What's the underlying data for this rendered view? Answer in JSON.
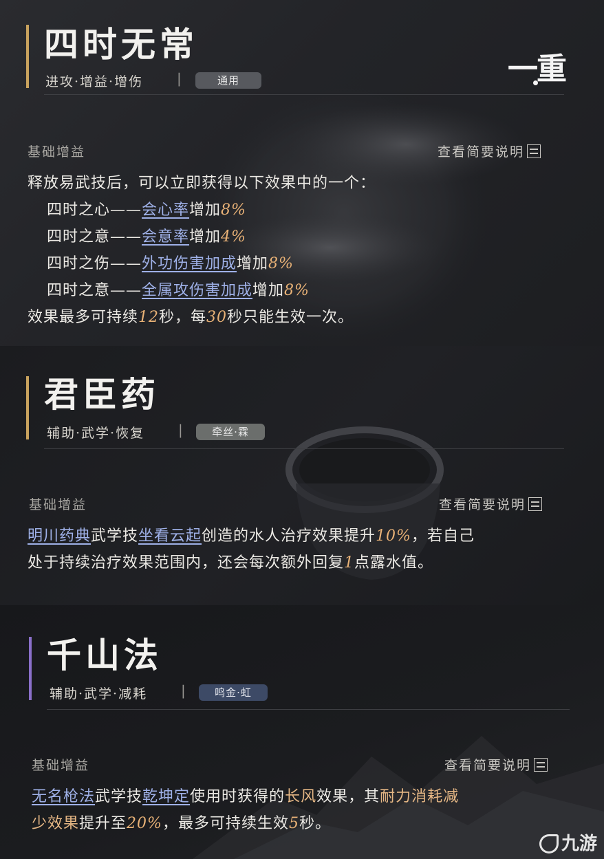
{
  "cards": [
    {
      "title": "四时无常",
      "tags": "进攻·增益·增伤",
      "chip": "通用",
      "rank": "一重",
      "section_label": "基础增益",
      "summary_label": "查看简要说明",
      "desc": {
        "l1": "释放易武技后，可以立即获得以下效果中的一个：",
        "r1": {
          "a": "四时之心——",
          "link": "会心率",
          "b": "增加",
          "num": "8%"
        },
        "r2": {
          "a": "四时之意——",
          "link": "会意率",
          "b": "增加",
          "num": "4%"
        },
        "r3": {
          "a": "四时之伤——",
          "link": "外功伤害加成",
          "b": "增加",
          "num": "8%"
        },
        "r4": {
          "a": "四时之意——",
          "link": "全属攻伤害加成",
          "b": "增加",
          "num": "8%"
        },
        "l6": {
          "a": "效果最多可持续",
          "n1": "12",
          "b": "秒，每",
          "n2": "30",
          "c": "秒只能生效一次。"
        }
      }
    },
    {
      "title": "君臣药",
      "tags": "辅助·武学·恢复",
      "chip": "牵丝·霖",
      "section_label": "基础增益",
      "summary_label": "查看简要说明",
      "desc": {
        "l1": {
          "link1": "明川药典",
          "a": "武学技",
          "link2": "坐看云起",
          "b": "创造的水人治疗效果提升",
          "num": "10%",
          "c": "，若自己"
        },
        "l2": {
          "a": "处于持续治疗效果范围内，还会每次额外回复",
          "num": "1",
          "b": "点露水值。"
        }
      }
    },
    {
      "title": "千山法",
      "tags": "辅助·武学·减耗",
      "chip": "鸣金·虹",
      "section_label": "基础增益",
      "summary_label": "查看简要说明",
      "desc": {
        "l1": {
          "link1": "无名枪法",
          "a": "武学技",
          "link2": "乾坤定",
          "b": "使用时获得的",
          "gold1": "长风",
          "c": "效果，其",
          "gold2": "耐力消耗减"
        },
        "l2": {
          "gold": "少效果",
          "a": "提升至",
          "num": "20%",
          "b": "，最多可持续生效",
          "num2": "5",
          "c": "秒。"
        }
      }
    }
  ],
  "watermark": "九游",
  "colors": {
    "accent_gold": "#c9a35e",
    "accent_purple": "#8a6fc9",
    "link": "#9fb1e8",
    "number": "#e9b277"
  }
}
